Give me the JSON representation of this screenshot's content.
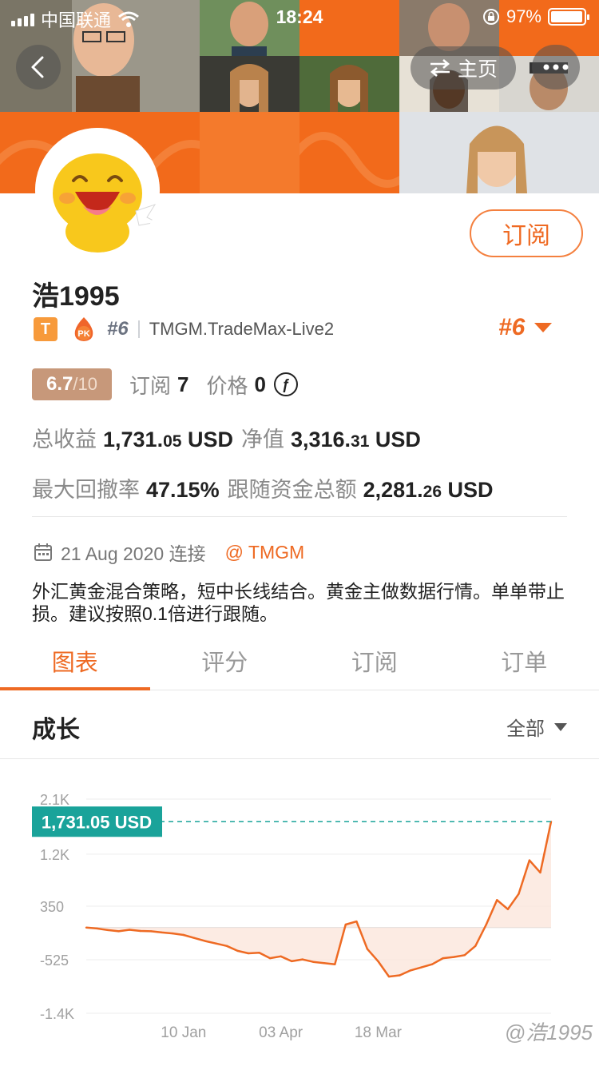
{
  "status_bar": {
    "carrier": "中国联通",
    "time": "18:24",
    "battery": "97%",
    "battery_level": 0.97
  },
  "header": {
    "home_label": "主页"
  },
  "profile": {
    "subscribe_label": "订阅",
    "username": "浩1995",
    "level_badge": "T",
    "pk_label": "PK",
    "rank": "#6",
    "server": "TMGM.TradeMax-Live2",
    "rank_right": "#6"
  },
  "stats": {
    "score": "6.7",
    "score_den": "/10",
    "subscribe_label": "订阅",
    "subscribe_count": "7",
    "price_label": "价格",
    "price_value": "0",
    "coin_symbol": "ƒ"
  },
  "metrics": {
    "total_profit_label": "总收益",
    "total_profit_main": "1,731.",
    "total_profit_dec": "05",
    "total_profit_unit": "USD",
    "equity_label": "净值",
    "equity_main": "3,316.",
    "equity_dec": "31",
    "equity_unit": "USD",
    "drawdown_label": "最大回撤率",
    "drawdown_value": "47.15%",
    "follow_label": "跟随资金总额",
    "follow_main": "2,281.",
    "follow_dec": "26",
    "follow_unit": "USD"
  },
  "info": {
    "join_date": "21 Aug 2020 连接",
    "broker": "@ TMGM",
    "description": "外汇黄金混合策略，短中长线结合。黄金主做数据行情。单单带止损。建议按照0.1倍进行跟随。"
  },
  "tabs": [
    {
      "label": "图表",
      "active": true
    },
    {
      "label": "评分",
      "active": false
    },
    {
      "label": "订阅",
      "active": false
    },
    {
      "label": "订单",
      "active": false
    }
  ],
  "section": {
    "title": "成长",
    "range": "全部"
  },
  "chart_data": {
    "type": "area",
    "title": "",
    "xlabel": "",
    "ylabel": "",
    "y_ticks": [
      "2.1K",
      "1.2K",
      "350",
      "-525",
      "-1.4K"
    ],
    "y_tick_values": [
      2100,
      1200,
      350,
      -525,
      -1400
    ],
    "ylim": [
      -1400,
      2100
    ],
    "x_ticks": [
      "10 Jan",
      "03 Apr",
      "18 Mar"
    ],
    "x_tick_positions": [
      9,
      18,
      27
    ],
    "current_label": "1,731.05 USD",
    "current_value": 1731.05,
    "series": [
      {
        "values": [
          0,
          -15,
          -40,
          -60,
          -35,
          -55,
          -60,
          -80,
          -95,
          -120,
          -170,
          -220,
          -260,
          -300,
          -380,
          -420,
          -410,
          -500,
          -470,
          -550,
          -520,
          -560,
          -580,
          -600,
          50,
          100,
          -350,
          -550,
          -800,
          -780,
          -700,
          -650,
          -600,
          -500,
          -480,
          -450,
          -300,
          50,
          450,
          300,
          550,
          1100,
          900,
          1731
        ]
      }
    ],
    "colors": {
      "line": "#ee6a23",
      "fill": "#fbe4d9",
      "marker": "#1aa39a"
    }
  },
  "watermark": "@浩1995"
}
